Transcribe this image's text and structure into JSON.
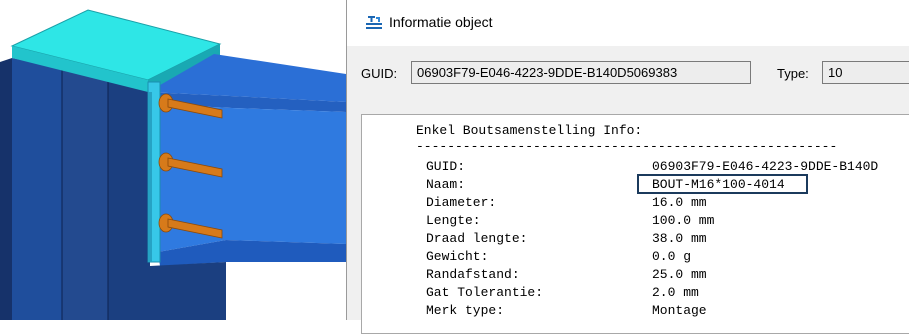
{
  "dialog": {
    "title": "Informatie object",
    "guid_label": "GUID:",
    "guid_value": "06903F79-E046-4223-9DDE-B140D5069383",
    "type_label": "Type:",
    "type_value": "10"
  },
  "info": {
    "heading": "Enkel Boutsamenstelling Info:",
    "separator": "------------------------------------------------------",
    "rows": [
      {
        "key": "GUID:",
        "value": "06903F79-E046-4223-9DDE-B140D"
      },
      {
        "key": "Naam:",
        "value": "BOUT-M16*100-4014"
      },
      {
        "key": "Diameter:",
        "value": "16.0 mm"
      },
      {
        "key": "Lengte:",
        "value": "100.0 mm"
      },
      {
        "key": "Draad lengte:",
        "value": "38.0 mm"
      },
      {
        "key": "Gewicht:",
        "value": "0.0 g"
      },
      {
        "key": "Randafstand:",
        "value": "25.0 mm"
      },
      {
        "key": "Gat Tolerantie:",
        "value": "2.0 mm"
      },
      {
        "key": "Merk type:",
        "value": "Montage"
      }
    ]
  },
  "icons": {
    "title_icon": "object-info-icon",
    "model": "steel-beam-column-connection"
  },
  "colors": {
    "column": "#1f4e9c",
    "beam": "#2b6fd6",
    "cap_plate": "#2ee6e6",
    "end_plate": "#37c8e8",
    "bolts": "#d77a1a",
    "highlight": "#1b3a5c"
  }
}
